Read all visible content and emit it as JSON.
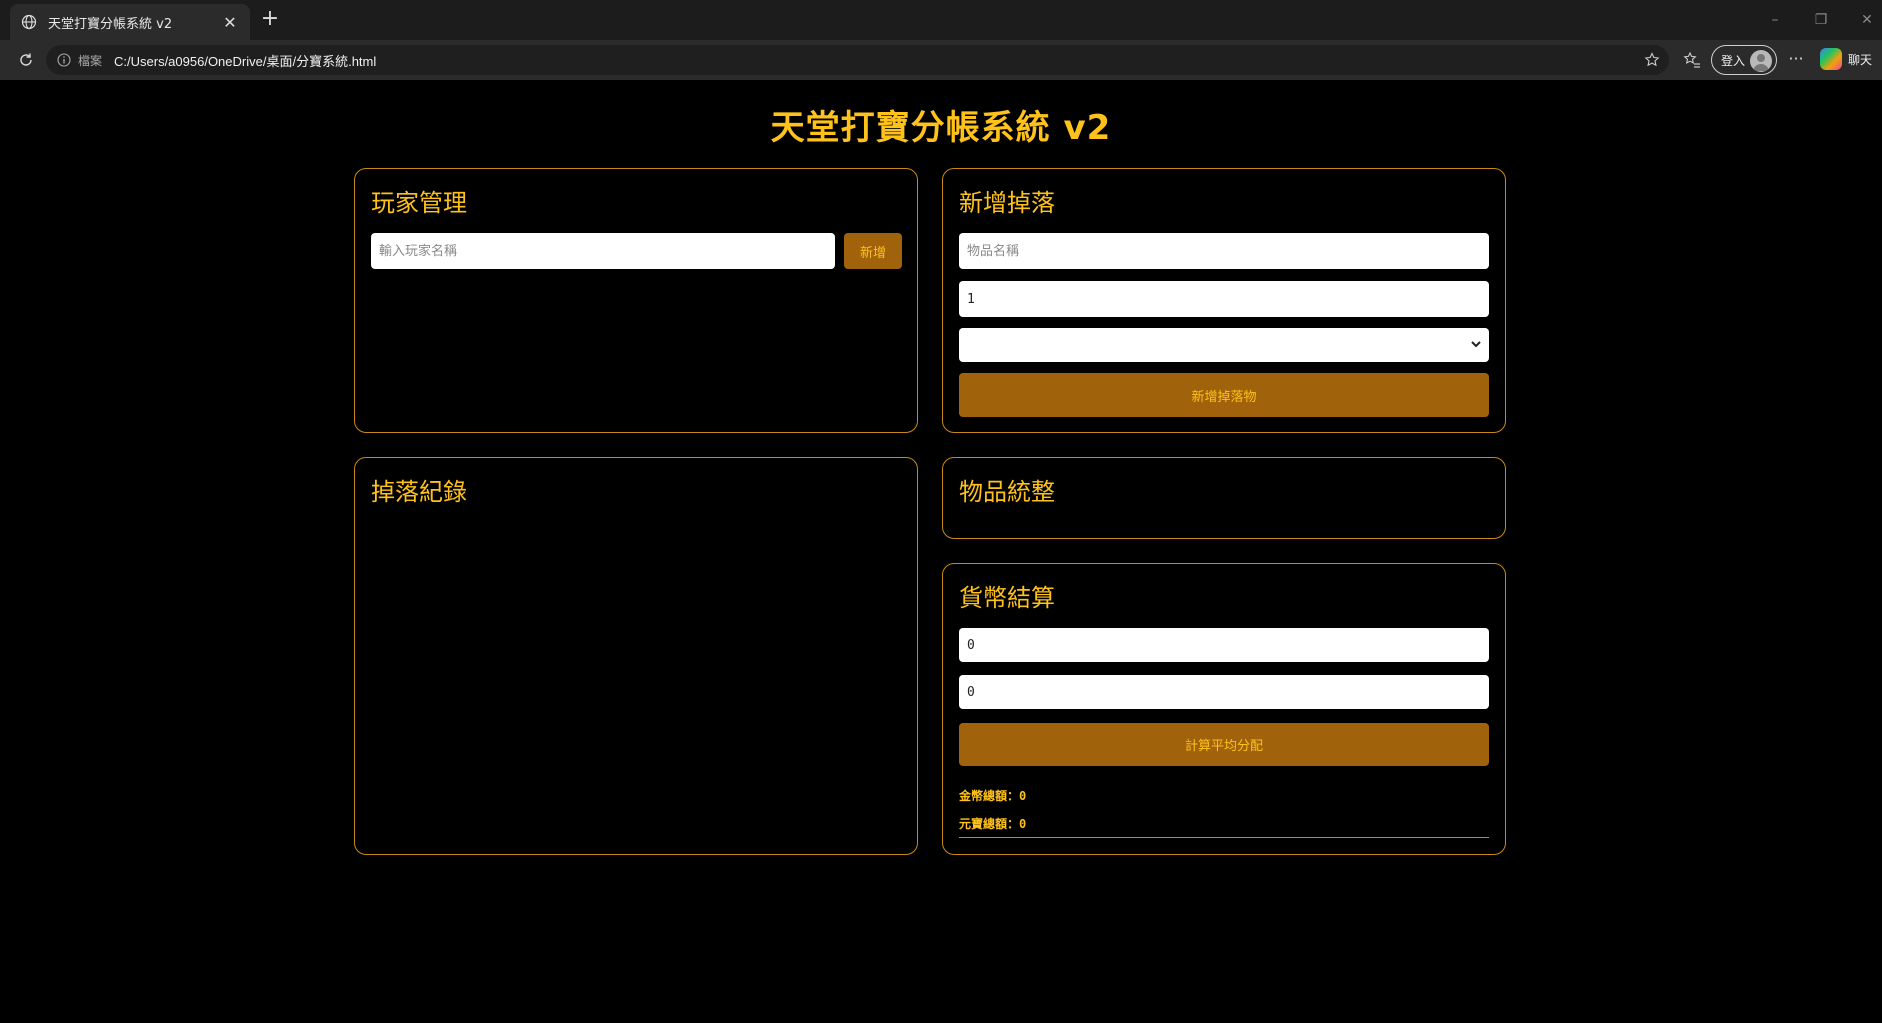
{
  "browser": {
    "tab_title": "天堂打寶分帳系統 v2",
    "address_protocol": "檔案",
    "address_url": "C:/Users/a0956/OneDrive/桌面/分寶系統.html",
    "signin_label": "登入",
    "copilot_label": "聊天"
  },
  "page": {
    "title": "天堂打寶分帳系統 v2"
  },
  "players": {
    "heading": "玩家管理",
    "name_placeholder": "輸入玩家名稱",
    "add_label": "新增"
  },
  "drop_form": {
    "heading": "新增掉落",
    "item_placeholder": "物品名稱",
    "quantity_value": "1",
    "player_select_value": "",
    "submit_label": "新增掉落物"
  },
  "drop_log": {
    "heading": "掉落紀錄"
  },
  "item_summary": {
    "heading": "物品統整"
  },
  "currency": {
    "heading": "貨幣結算",
    "gold_value": "0",
    "yuanbao_value": "0",
    "calculate_label": "計算平均分配",
    "gold_total_label": "金幣總額：",
    "gold_total_value": "0",
    "yuanbao_total_label": "元寶總額：",
    "yuanbao_total_value": "0"
  },
  "colors": {
    "accent": "#ffc21a",
    "border": "#c98a12",
    "button_bg": "#a0620a",
    "background": "#000000"
  }
}
